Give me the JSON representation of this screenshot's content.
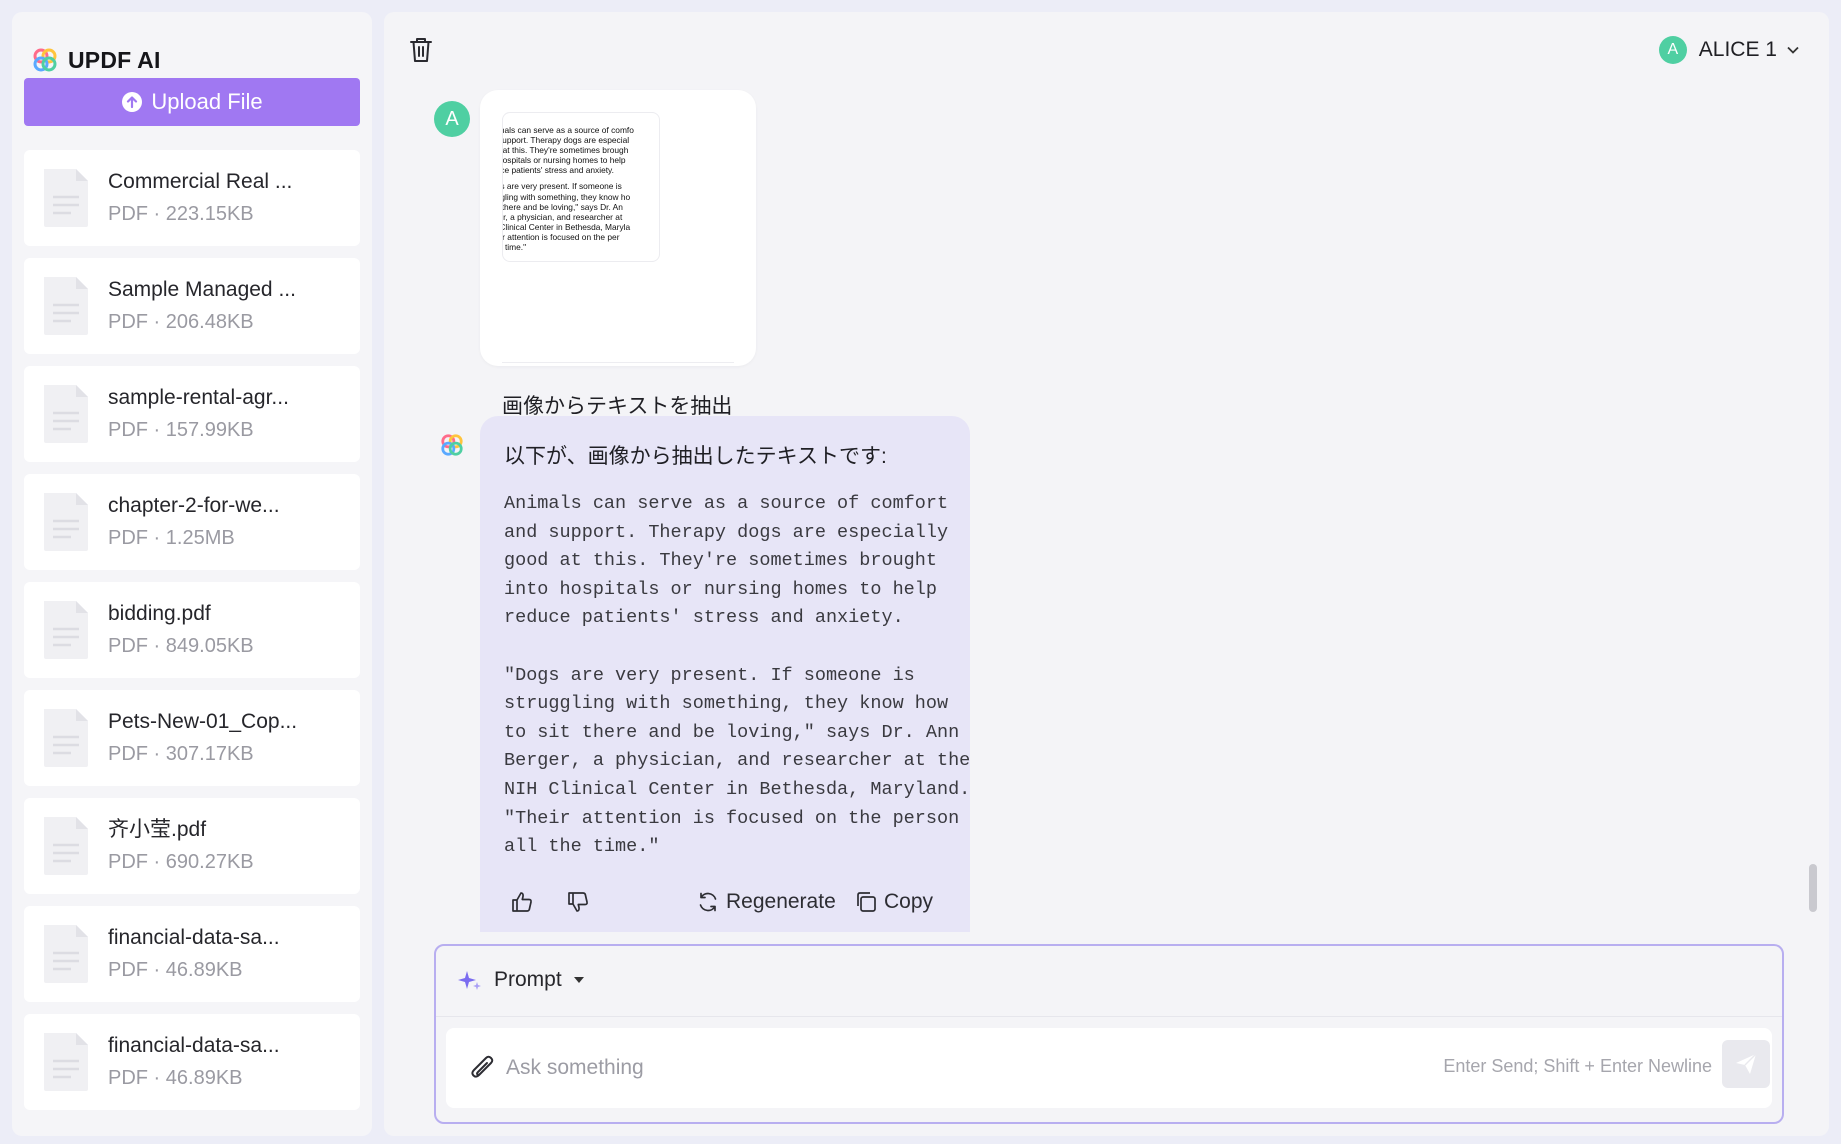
{
  "app": {
    "name": "UPDF AI"
  },
  "sidebar": {
    "upload_label": "Upload File",
    "files": [
      {
        "name": "Commercial Real ...",
        "meta": "PDF · 223.15KB"
      },
      {
        "name": "Sample Managed ...",
        "meta": "PDF · 206.48KB"
      },
      {
        "name": "sample-rental-agr...",
        "meta": "PDF · 157.99KB"
      },
      {
        "name": "chapter-2-for-we...",
        "meta": "PDF · 1.25MB"
      },
      {
        "name": "bidding.pdf",
        "meta": "PDF · 849.05KB"
      },
      {
        "name": "Pets-New-01_Cop...",
        "meta": "PDF · 307.17KB"
      },
      {
        "name": "齐小莹.pdf",
        "meta": "PDF · 690.27KB"
      },
      {
        "name": "financial-data-sa...",
        "meta": "PDF · 46.89KB"
      },
      {
        "name": "financial-data-sa...",
        "meta": "PDF · 46.89KB"
      }
    ]
  },
  "header": {
    "user_initial": "A",
    "user_name": "ALICE 1"
  },
  "chat": {
    "user_message": {
      "avatar_initial": "A",
      "thumbnail_lines": [
        "nimals can serve as a source of comfo",
        "d support. Therapy dogs are especial",
        "od at this. They're sometimes brough",
        "o hospitals or nursing homes to help",
        "duce patients' stress and anxiety.",
        "",
        "ogs are very present. If someone is",
        "uggling with something, they know ho",
        "sit there and be loving,\" says Dr. An",
        "rger, a physician, and researcher at",
        "H Clinical Center in Bethesda, Maryla",
        "heir attention is focused on the per",
        "the time.\""
      ],
      "caption": "画像からテキストを抽出"
    },
    "ai_message": {
      "intro": "以下が、画像から抽出したテキストです:",
      "body": "Animals can serve as a source of comfort\nand support. Therapy dogs are especially\ngood at this. They're sometimes brought\ninto hospitals or nursing homes to help\nreduce patients' stress and anxiety.\n\n\"Dogs are very present. If someone is\nstruggling with something, they know how\nto sit there and be loving,\" says Dr. Ann\nBerger, a physician, and researcher at the\nNIH Clinical Center in Bethesda, Maryland.\n\"Their attention is focused on the person\nall the time.\"",
      "regenerate_label": "Regenerate",
      "copy_label": "Copy"
    }
  },
  "composer": {
    "mode_label": "Prompt",
    "placeholder": "Ask something",
    "hint": "Enter Send; Shift + Enter Newline"
  },
  "colors": {
    "accent": "#a078f2",
    "avatar": "#4fcfa2",
    "ai_bubble": "#e7e5f7"
  },
  "icons": [
    "updf-logo-icon",
    "upload-icon",
    "pdf-file-icon",
    "trash-icon",
    "chevron-down-icon",
    "thumbs-up-icon",
    "thumbs-down-icon",
    "regenerate-icon",
    "copy-icon",
    "sparkle-icon",
    "caret-down-icon",
    "paperclip-icon",
    "send-icon"
  ]
}
